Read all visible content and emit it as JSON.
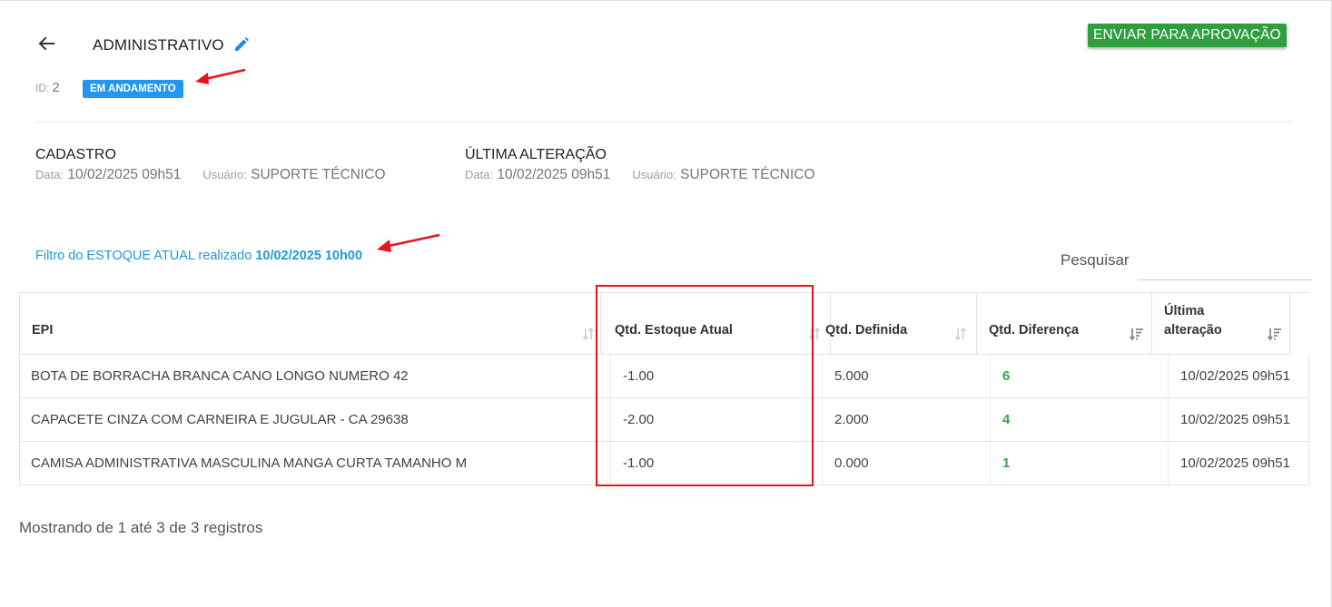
{
  "header": {
    "title": "ADMINISTRATIVO",
    "approve_label": "ENVIAR PARA APROVAÇÃO",
    "id_label": "ID:",
    "id_value": "2",
    "status": "EM ANDAMENTO"
  },
  "cadastro": {
    "title": "CADASTRO",
    "date_label": "Data:",
    "date_value": "10/02/2025 09h51",
    "user_label": "Usuário:",
    "user_value": "SUPORTE TÉCNICO"
  },
  "ultima_alteracao": {
    "title": "ÚLTIMA ALTERAÇÃO",
    "date_label": "Data:",
    "date_value": "10/02/2025 09h51",
    "user_label": "Usuário:",
    "user_value": "SUPORTE TÉCNICO"
  },
  "filter": {
    "text": "Filtro do ESTOQUE ATUAL realizado",
    "timestamp": "10/02/2025 10h00"
  },
  "search": {
    "label": "Pesquisar",
    "value": ""
  },
  "table": {
    "columns": [
      {
        "label": "EPI",
        "sort": "none"
      },
      {
        "label": "Qtd. Estoque Atual",
        "sort": "none"
      },
      {
        "label": "Qtd. Definida",
        "sort": "none"
      },
      {
        "label": "Qtd. Diferença",
        "sort": "desc"
      },
      {
        "label": "Última alteração",
        "sort": "desc"
      }
    ],
    "rows": [
      [
        "BOTA DE BORRACHA BRANCA CANO LONGO NUMERO 42",
        "-1.00",
        "5.000",
        "6",
        "10/02/2025 09h51"
      ],
      [
        "CAPACETE CINZA COM CARNEIRA E JUGULAR - CA 29638",
        "-2.00",
        "2.000",
        "4",
        "10/02/2025 09h51"
      ],
      [
        "CAMISA ADMINISTRATIVA MASCULINA MANGA CURTA TAMANHO M",
        "-1.00",
        "0.000",
        "1",
        "10/02/2025 09h51"
      ]
    ]
  },
  "footer": {
    "records_info": "Mostrando de 1 até 3 de 3 registros"
  },
  "colors": {
    "primary_blue": "#2196f3",
    "link_blue": "#1e9ad6",
    "approve_green": "#2e9e3e",
    "diff_green": "#3fa34d",
    "annotation_red": "#e8141a"
  }
}
